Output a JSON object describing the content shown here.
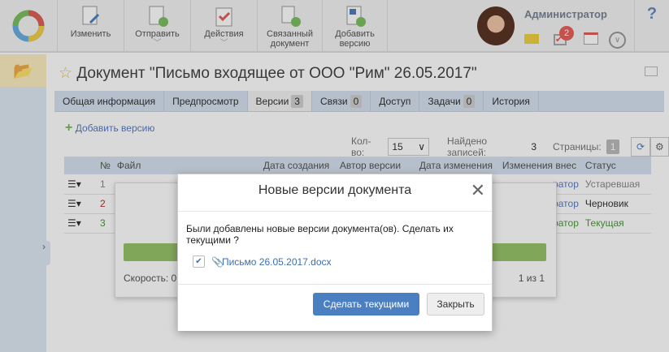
{
  "toolbar": {
    "items": [
      {
        "label": "Изменить"
      },
      {
        "label": "Отправить"
      },
      {
        "label": "Действия"
      },
      {
        "label": "Связанный документ"
      },
      {
        "label": "Добавить версию"
      }
    ],
    "user": "Администратор",
    "task_badge": "2",
    "help": "?"
  },
  "document": {
    "title": "Документ \"Письмо входящее от ООО \"Рим\" 26.05.2017\""
  },
  "tabs": [
    {
      "label": "Общая информация"
    },
    {
      "label": "Предпросмотр"
    },
    {
      "label": "Версии",
      "count": "3"
    },
    {
      "label": "Связи",
      "count": "0"
    },
    {
      "label": "Доступ"
    },
    {
      "label": "Задачи",
      "count": "0"
    },
    {
      "label": "История"
    }
  ],
  "versions": {
    "add_label": "Добавить версию",
    "qty_label": "Кол-во:",
    "qty_value": "15",
    "found_label": "Найдено записей:",
    "found_value": "3",
    "pages_label": "Страницы:",
    "page": "1",
    "columns": [
      "№",
      "Файл",
      "Дата создания",
      "Автор версии",
      "Дата изменения",
      "Изменения внес",
      "Статус"
    ],
    "rows": [
      {
        "n": "1",
        "changed": "ратор",
        "status": "Устаревшая"
      },
      {
        "n": "2",
        "changed": "ратор",
        "status": "Черновик"
      },
      {
        "n": "3",
        "changed": "ратор",
        "status": "Текущая"
      }
    ]
  },
  "progress": {
    "speed": "Скорость:  0",
    "count": "1 из 1"
  },
  "modal": {
    "title": "Новые версии документа",
    "message": "Были добавлены новые версии документа(ов). Сделать их текущими ?",
    "file": "Письмо 26.05.2017.docx",
    "primary": "Сделать текущими",
    "close": "Закрыть"
  },
  "colors": {
    "accent": "#4a7fc1",
    "current": "#4a9a3a",
    "draft": "#333333"
  }
}
